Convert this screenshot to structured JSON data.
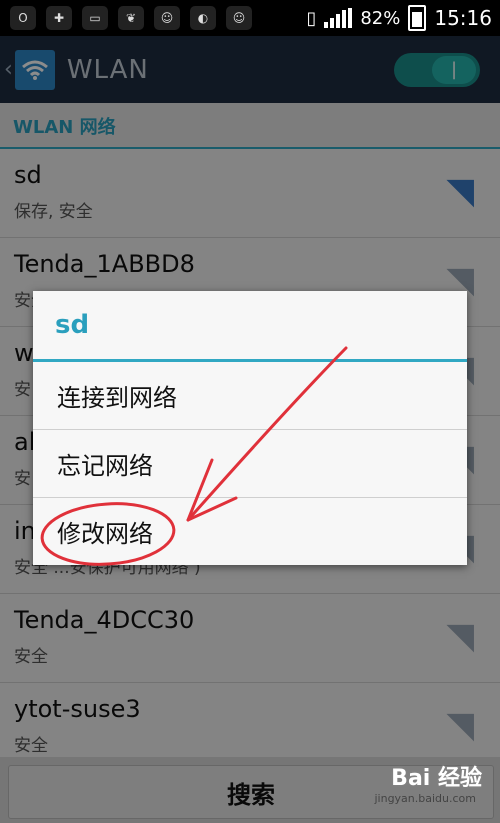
{
  "status_bar": {
    "notification_icons": [
      "opera-icon",
      "plus-icon",
      "battery-app-icon",
      "leaf-icon",
      "avatar-icon",
      "wechat-icon",
      "avatar-icon"
    ],
    "battery_percent": "82%",
    "time": "15:16"
  },
  "action_bar": {
    "title": "WLAN",
    "wifi_enabled": true
  },
  "section": {
    "header": "WLAN 网络"
  },
  "networks": [
    {
      "name": "sd",
      "status": "保存, 安全",
      "signal": "strong"
    },
    {
      "name": "Tenda_1ABBD8",
      "status": "安全",
      "signal": "weak"
    },
    {
      "name": "w",
      "status": "安",
      "signal": "weak"
    },
    {
      "name": "al",
      "status": "安",
      "signal": "weak"
    },
    {
      "name": "in",
      "status": "安全 ...安保护可用网络 )",
      "signal": "weak"
    },
    {
      "name": "Tenda_4DCC30",
      "status": "安全",
      "signal": "weak"
    },
    {
      "name": "ytot-suse3",
      "status": "安全",
      "signal": "weak"
    }
  ],
  "dialog": {
    "title": "sd",
    "items": [
      {
        "label": "连接到网络"
      },
      {
        "label": "忘记网络"
      },
      {
        "label": "修改网络"
      }
    ]
  },
  "bottom_bar": {
    "search_label": "搜索"
  },
  "watermark": {
    "logo": "Bai 经验",
    "url": "jingyan.baidu.com"
  },
  "colors": {
    "accent": "#31a8c3",
    "actionbar": "#1e2d40",
    "annotation": "#e0313a"
  }
}
